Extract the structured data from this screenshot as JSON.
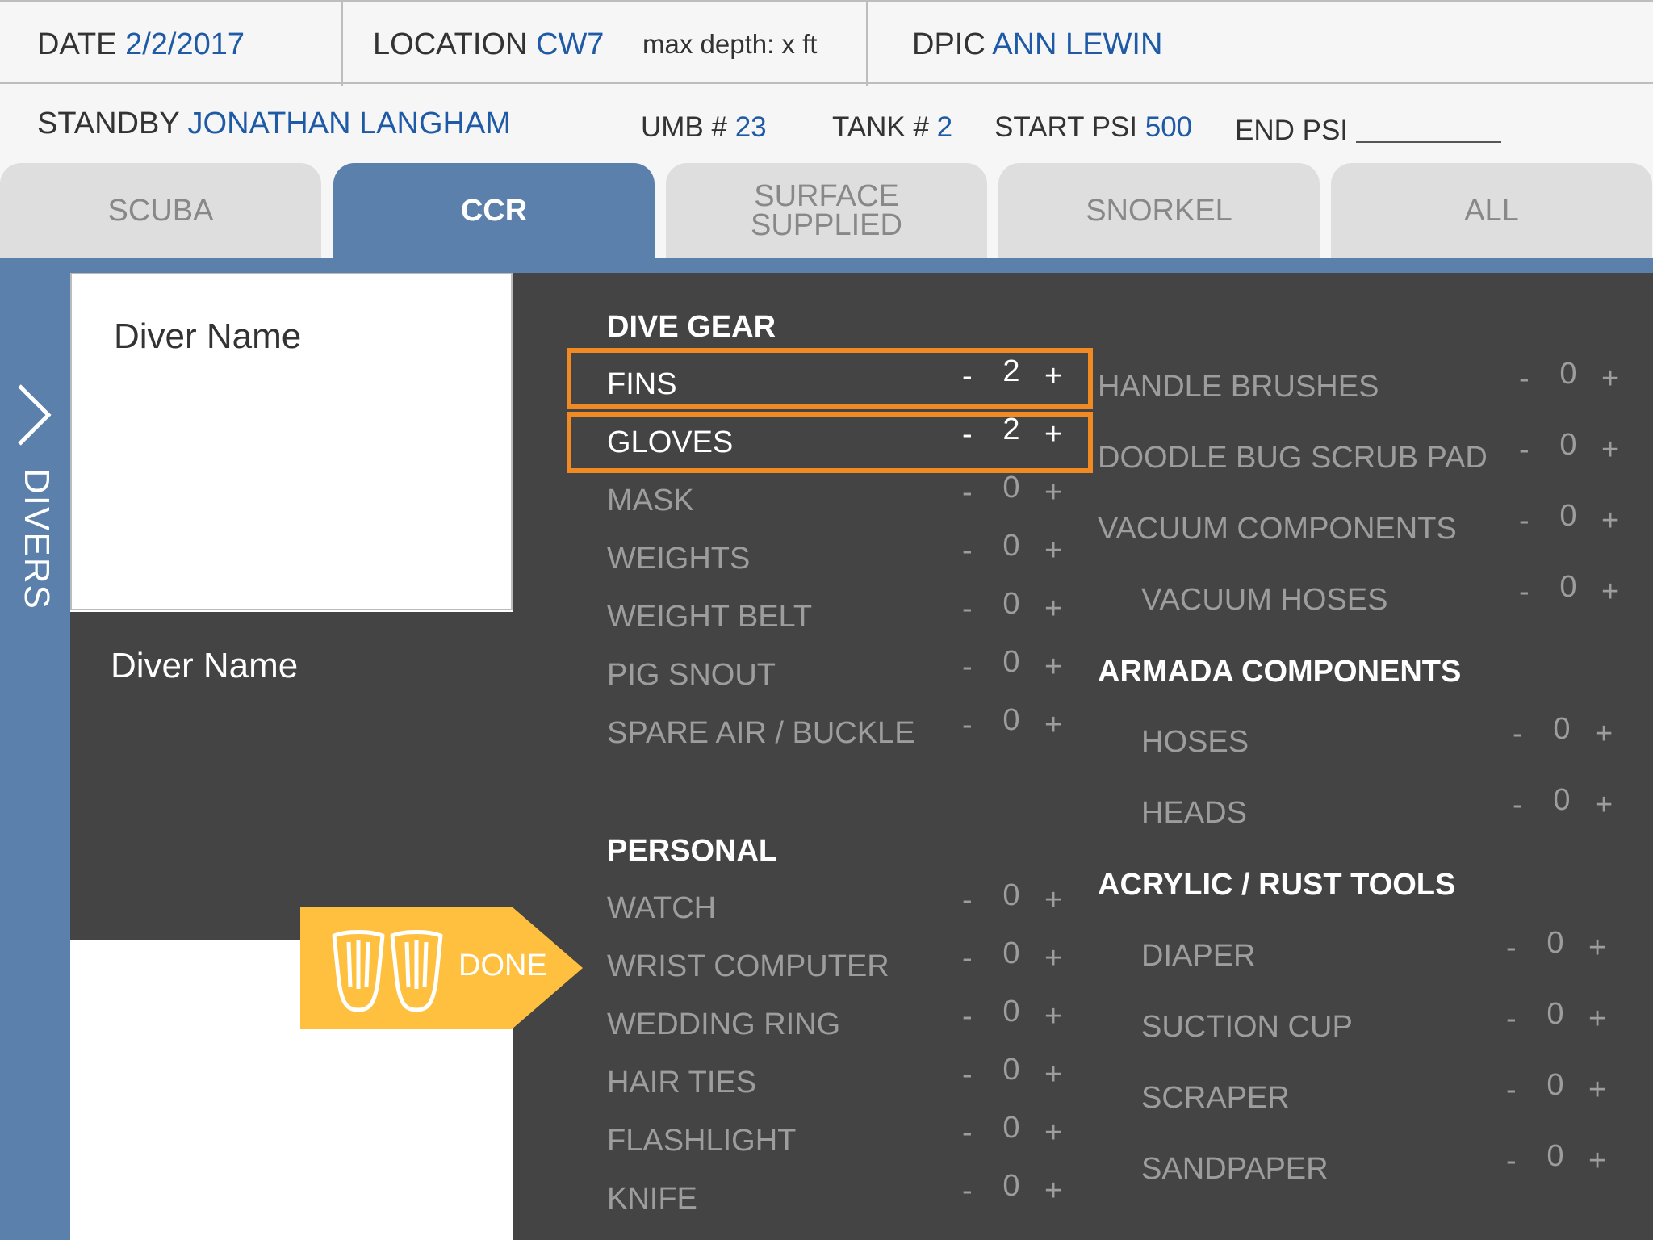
{
  "header": {
    "date_label": "DATE",
    "date_value": "2/2/2017",
    "location_label": "LOCATION",
    "location_value": "CW7",
    "max_depth": "max depth: x ft",
    "dpic_label": "DPIC",
    "dpic_value": "ANN LEWIN",
    "standby_label": "STANDBY",
    "standby_value": "JONATHAN LANGHAM",
    "umb_label": "UMB #",
    "umb_value": "23",
    "tank_label": "TANK #",
    "tank_value": "2",
    "start_psi_label": "START PSI",
    "start_psi_value": "500",
    "end_psi_label": "END PSI",
    "end_psi_value": ""
  },
  "tabs": [
    {
      "label": "SCUBA",
      "active": false
    },
    {
      "label": "CCR",
      "active": true
    },
    {
      "label": "SURFACE\nSUPPLIED",
      "label_line1": "SURFACE",
      "label_line2": "SUPPLIED",
      "active": false
    },
    {
      "label": "SNORKEL",
      "active": false
    },
    {
      "label": "ALL",
      "active": false
    }
  ],
  "rail": {
    "label": "DIVERS",
    "icon": "chevron-right-icon"
  },
  "divers": [
    {
      "name": "Diver Name",
      "selected": false
    },
    {
      "name": "Diver Name",
      "selected": true
    }
  ],
  "done_button": {
    "label": "DONE",
    "icon": "fins-icon",
    "color": "#ffc040"
  },
  "colors": {
    "accent": "#5b80ab",
    "highlight": "#f28a24",
    "panel": "#444444",
    "link_value": "#1e5aa6"
  },
  "dive_gear": {
    "title": "DIVE GEAR",
    "items": [
      {
        "label": "FINS",
        "qty": "2"
      },
      {
        "label": "GLOVES",
        "qty": "2"
      },
      {
        "label": "MASK",
        "qty": "0"
      },
      {
        "label": "WEIGHTS",
        "qty": "0"
      },
      {
        "label": "WEIGHT BELT",
        "qty": "0"
      },
      {
        "label": "PIG SNOUT",
        "qty": "0"
      },
      {
        "label": "SPARE AIR / BUCKLE",
        "qty": "0"
      }
    ]
  },
  "personal": {
    "title": "PERSONAL",
    "items": [
      {
        "label": "WATCH",
        "qty": "0"
      },
      {
        "label": "WRIST COMPUTER",
        "qty": "0"
      },
      {
        "label": "WEDDING RING",
        "qty": "0"
      },
      {
        "label": "HAIR TIES",
        "qty": "0"
      },
      {
        "label": "FLASHLIGHT",
        "qty": "0"
      },
      {
        "label": "KNIFE",
        "qty": "0"
      }
    ]
  },
  "tools": {
    "items": [
      {
        "label": "HANDLE BRUSHES",
        "qty": "0"
      },
      {
        "label": "DOODLE BUG SCRUB PAD",
        "qty": "0"
      },
      {
        "label": "VACUUM COMPONENTS",
        "qty": "0"
      },
      {
        "label": "VACUUM HOSES",
        "qty": "0"
      }
    ]
  },
  "armada": {
    "title": "ARMADA COMPONENTS",
    "items": [
      {
        "label": "HOSES",
        "qty": "0"
      },
      {
        "label": "HEADS",
        "qty": "0"
      }
    ]
  },
  "acrylic": {
    "title": "ACRYLIC / RUST TOOLS",
    "items": [
      {
        "label": "DIAPER",
        "qty": "0"
      },
      {
        "label": "SUCTION CUP",
        "qty": "0"
      },
      {
        "label": "SCRAPER",
        "qty": "0"
      },
      {
        "label": "SANDPAPER",
        "qty": "0"
      }
    ]
  },
  "counter_symbols": {
    "minus": "-",
    "plus": "+"
  }
}
